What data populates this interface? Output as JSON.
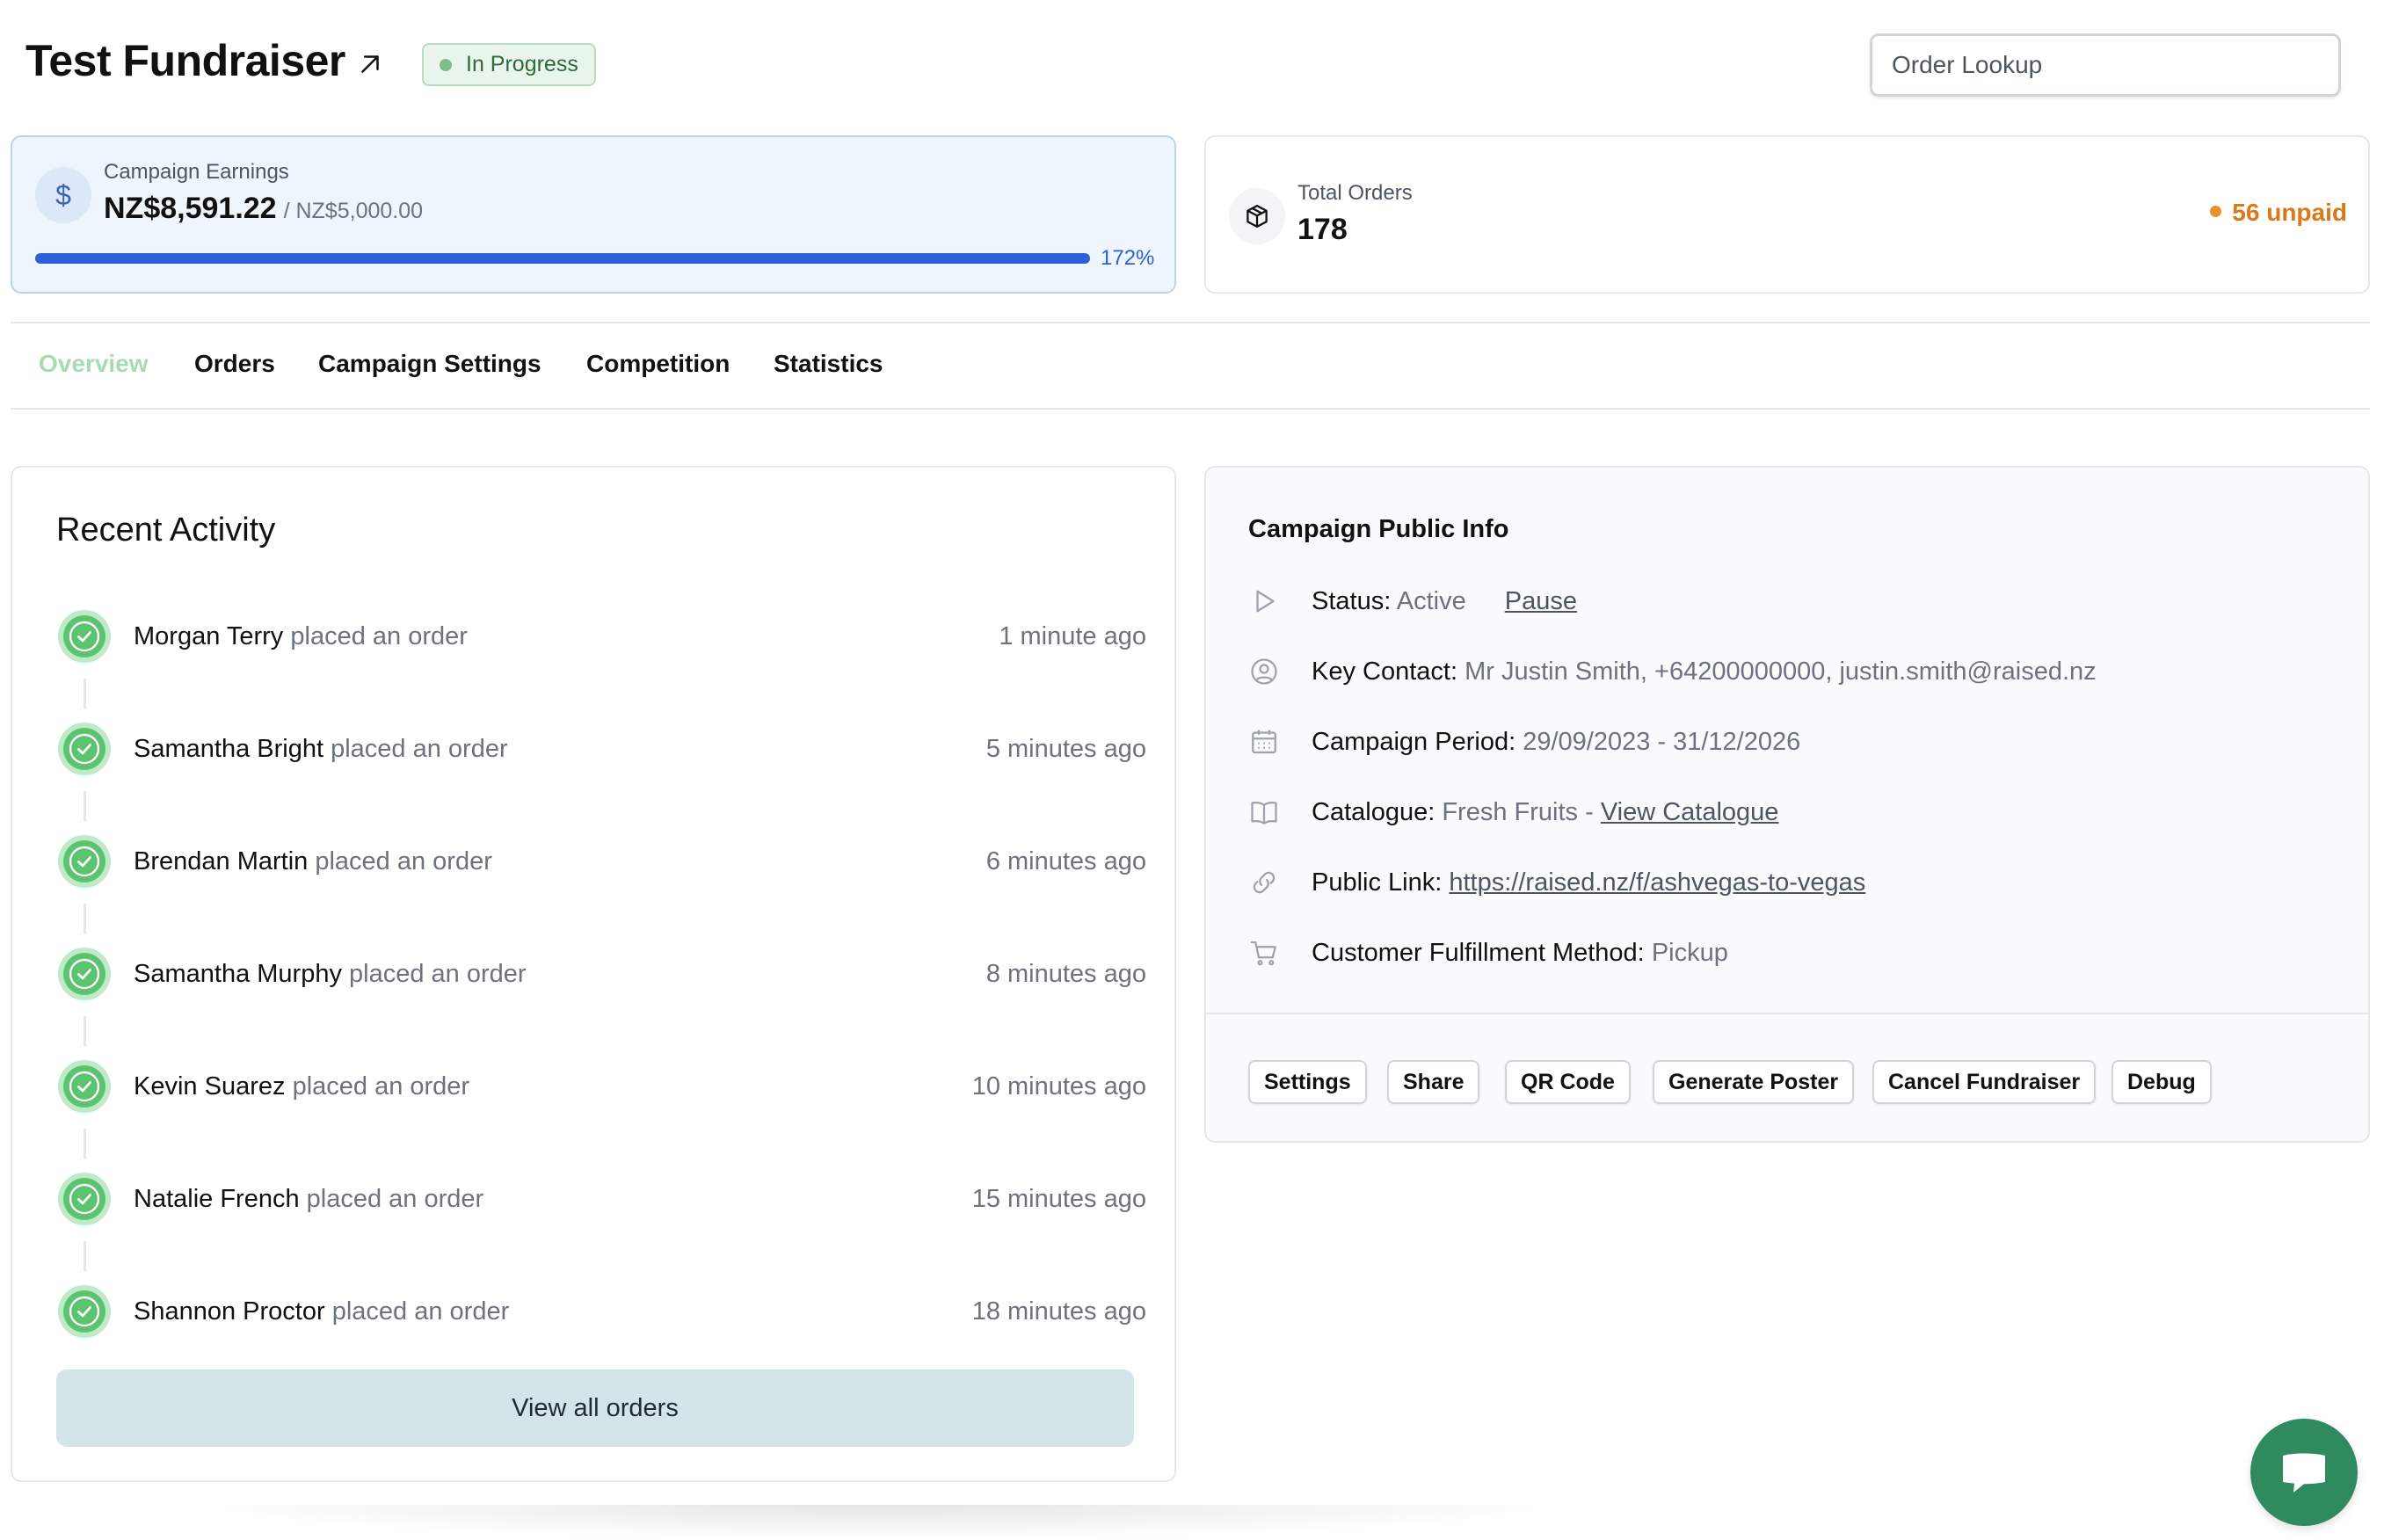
{
  "header": {
    "title": "Test Fundraiser",
    "status_badge": "In Progress",
    "order_lookup_placeholder": "Order Lookup"
  },
  "earnings": {
    "label": "Campaign Earnings",
    "value": "NZ$8,591.22",
    "goal": "/ NZ$5,000.00",
    "progress_percent_label": "172%",
    "progress_fill_fraction": 1.0
  },
  "orders_card": {
    "label": "Total Orders",
    "value": "178",
    "unpaid": "56 unpaid"
  },
  "tabs": [
    {
      "label": "Overview",
      "active": true
    },
    {
      "label": "Orders",
      "active": false
    },
    {
      "label": "Campaign Settings",
      "active": false
    },
    {
      "label": "Competition",
      "active": false
    },
    {
      "label": "Statistics",
      "active": false
    }
  ],
  "activity": {
    "title": "Recent Activity",
    "items": [
      {
        "name": "Morgan Terry",
        "action": "placed an order",
        "time": "1 minute ago"
      },
      {
        "name": "Samantha Bright",
        "action": "placed an order",
        "time": "5 minutes ago"
      },
      {
        "name": "Brendan Martin",
        "action": "placed an order",
        "time": "6 minutes ago"
      },
      {
        "name": "Samantha Murphy",
        "action": "placed an order",
        "time": "8 minutes ago"
      },
      {
        "name": "Kevin Suarez",
        "action": "placed an order",
        "time": "10 minutes ago"
      },
      {
        "name": "Natalie French",
        "action": "placed an order",
        "time": "15 minutes ago"
      },
      {
        "name": "Shannon Proctor",
        "action": "placed an order",
        "time": "18 minutes ago"
      }
    ],
    "view_all_label": "View all orders"
  },
  "public_info": {
    "title": "Campaign Public Info",
    "status_key": "Status:",
    "status_value": "Active",
    "pause_label": "Pause",
    "key_contact_key": "Key Contact:",
    "key_contact_value": "Mr Justin Smith, +64200000000, justin.smith@raised.nz",
    "period_key": "Campaign Period:",
    "period_value": "29/09/2023 - 31/12/2026",
    "catalogue_key": "Catalogue:",
    "catalogue_value": "Fresh Fruits -",
    "catalogue_link": "View Catalogue",
    "public_link_key": "Public Link:",
    "public_link_value": "https://raised.nz/f/ashvegas-to-vegas",
    "fulfillment_key": "Customer Fulfillment Method:",
    "fulfillment_value": "Pickup",
    "buttons": {
      "settings": "Settings",
      "share": "Share",
      "qr_code": "QR Code",
      "generate_poster": "Generate Poster",
      "cancel_fundraiser": "Cancel Fundraiser",
      "debug": "Debug"
    }
  },
  "colors": {
    "accent_blue": "#2f5fd8",
    "success_green": "#5cc46f",
    "unpaid_orange": "#d97a1a",
    "chat_green": "#2f8a60",
    "tab_active": "#a7dbb4"
  }
}
